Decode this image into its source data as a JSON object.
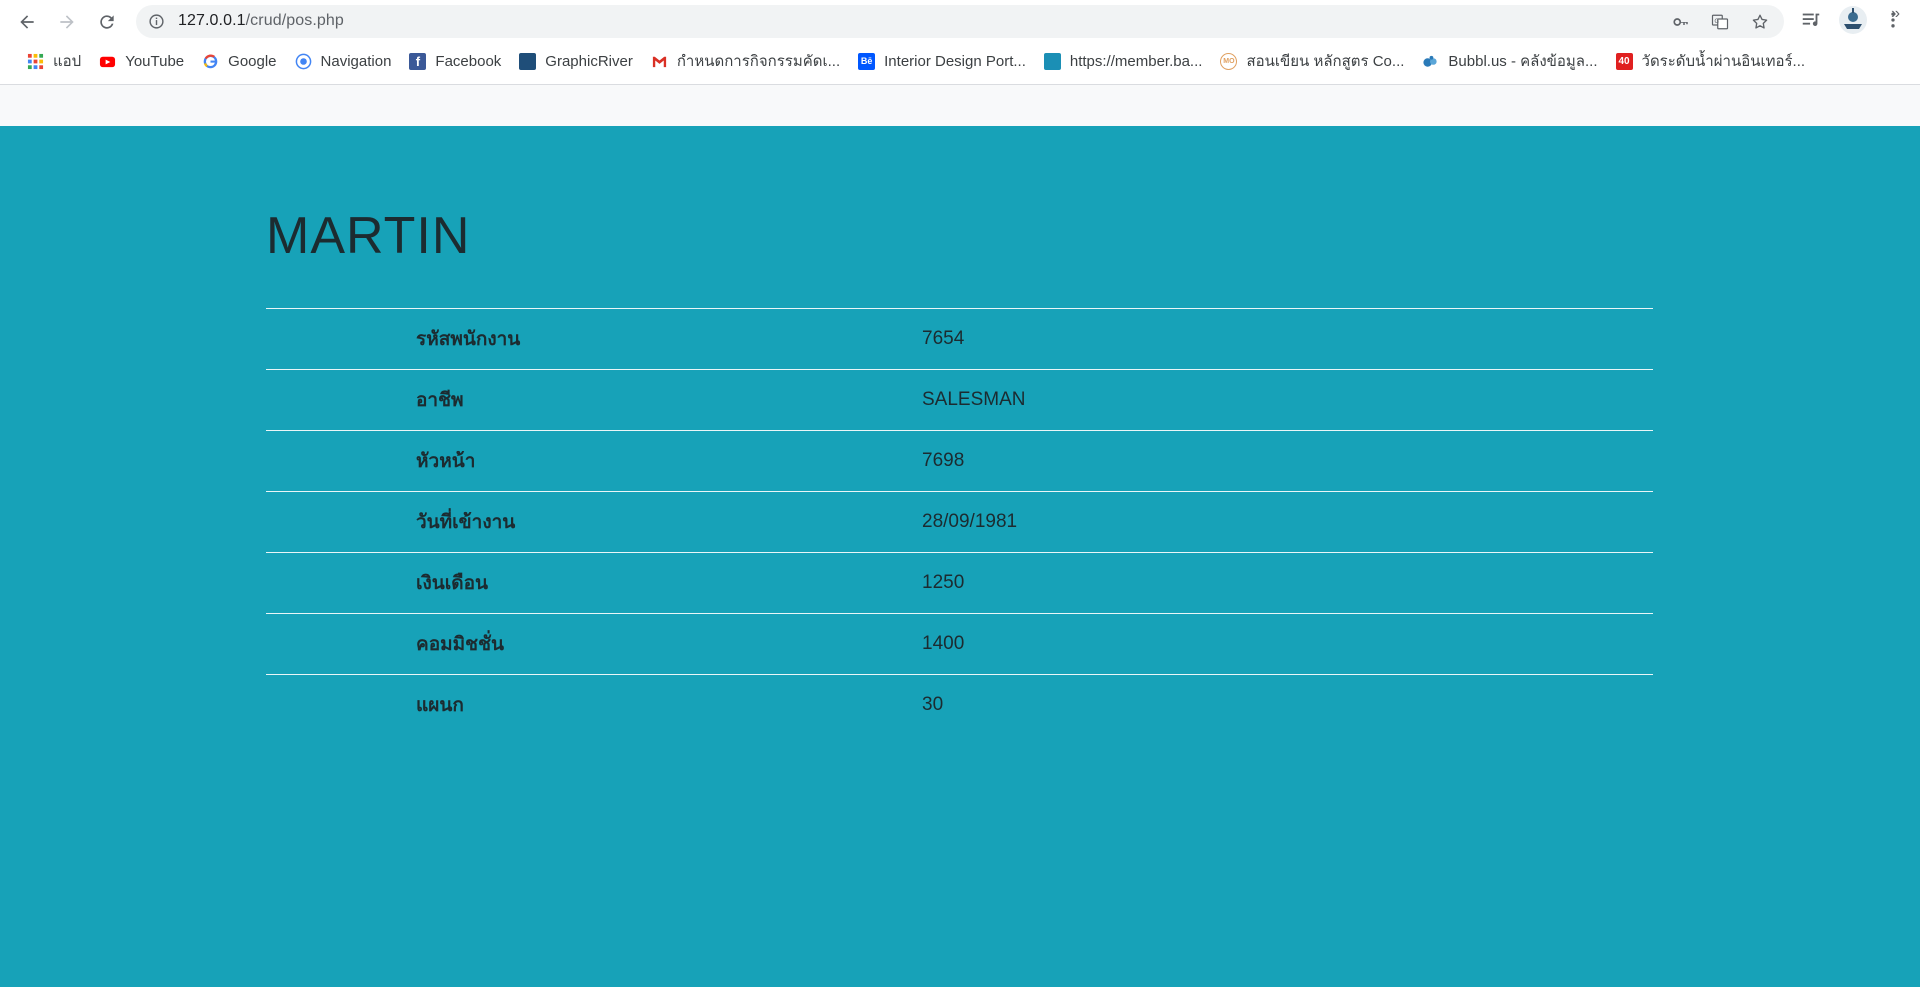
{
  "browser": {
    "url_host": "127.0.0.1",
    "url_path": "/crud/pos.php",
    "bookmarks": [
      {
        "label": "แอป",
        "icon": "apps-grid-icon",
        "color": "#ea4335"
      },
      {
        "label": "YouTube",
        "icon": "youtube-icon",
        "color": "#ff0000"
      },
      {
        "label": "Google",
        "icon": "google-icon",
        "color": "#4285f4"
      },
      {
        "label": "Navigation",
        "icon": "navigation-icon",
        "color": "#4285f4"
      },
      {
        "label": "Facebook",
        "icon": "facebook-icon",
        "color": "#3b5998"
      },
      {
        "label": "GraphicRiver",
        "icon": "graphicriver-icon",
        "color": "#1f4e79"
      },
      {
        "label": "กำหนดการกิจกรรมคัดเ...",
        "icon": "gmail-icon",
        "color": "#d93025"
      },
      {
        "label": "Interior Design Port...",
        "icon": "behance-icon",
        "color": "#0057ff"
      },
      {
        "label": "https://member.ba...",
        "icon": "site-icon",
        "color": "#1b8fb5"
      },
      {
        "label": "สอนเขียน หลักสูตร Co...",
        "icon": "mo-icon",
        "color": "#e0a060"
      },
      {
        "label": "Bubbl.us - คลังข้อมูล...",
        "icon": "bubbl-icon",
        "color": "#2a7ab8"
      },
      {
        "label": "วัดระดับน้ำผ่านอินเทอร์...",
        "icon": "forty-icon",
        "color": "#e02020"
      }
    ],
    "more_label": "»"
  },
  "page": {
    "title": "MARTIN",
    "rows": [
      {
        "label": "รหัสพนักงาน",
        "value": "7654"
      },
      {
        "label": "อาชีพ",
        "value": "SALESMAN"
      },
      {
        "label": "หัวหน้า",
        "value": "7698"
      },
      {
        "label": "วันที่เข้างาน",
        "value": "28/09/1981"
      },
      {
        "label": "เงินเดือน",
        "value": "1250"
      },
      {
        "label": "คอมมิชชั่น",
        "value": "1400"
      },
      {
        "label": "แผนก",
        "value": "30"
      }
    ]
  },
  "colors": {
    "page_bg": "#17a2b8",
    "navbar_bg": "#f8f9fa",
    "text": "#1c2b30"
  }
}
